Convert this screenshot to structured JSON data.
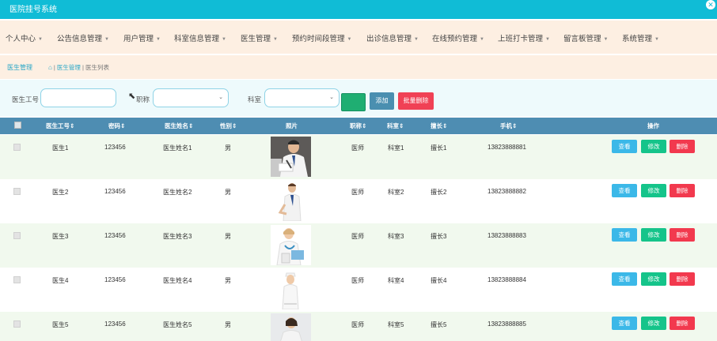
{
  "app": {
    "title": "医院挂号系统",
    "close_icon": "close-circle-icon"
  },
  "nav": {
    "items": [
      "个人中心",
      "公告信息管理",
      "用户管理",
      "科室信息管理",
      "医生管理",
      "预约时间段管理",
      "出诊信息管理",
      "在线预约管理",
      "上班打卡管理",
      "留言板管理",
      "系统管理"
    ]
  },
  "breadcrumb": {
    "section": "医生管理",
    "home_icon": "home-icon",
    "path": "医生管理",
    "current": "医生列表",
    "separator": "|"
  },
  "filters": {
    "doctor_no_label": "医生工号",
    "doctor_no_value": "",
    "title_label": "职称",
    "title_value": "",
    "dept_label": "科室",
    "dept_value": "",
    "search_label": "",
    "add_label": "添加",
    "bulk_delete_label": "批量删除"
  },
  "table": {
    "columns": [
      "医生工号",
      "密码",
      "医生姓名",
      "性别",
      "照片",
      "职称",
      "科室",
      "擅长",
      "手机",
      "操作"
    ],
    "sortable_icon": "sort-icon",
    "rows": [
      {
        "doctor_no": "医生1",
        "password": "123456",
        "name": "医生姓名1",
        "gender": "男",
        "photo": "doctor-photo-1",
        "title": "医师",
        "dept": "科室1",
        "specialty": "擅长1",
        "phone": "13823888881"
      },
      {
        "doctor_no": "医生2",
        "password": "123456",
        "name": "医生姓名2",
        "gender": "男",
        "photo": "doctor-photo-2",
        "title": "医师",
        "dept": "科室2",
        "specialty": "擅长2",
        "phone": "13823888882"
      },
      {
        "doctor_no": "医生3",
        "password": "123456",
        "name": "医生姓名3",
        "gender": "男",
        "photo": "doctor-photo-3",
        "title": "医师",
        "dept": "科室3",
        "specialty": "擅长3",
        "phone": "13823888883"
      },
      {
        "doctor_no": "医生4",
        "password": "123456",
        "name": "医生姓名4",
        "gender": "男",
        "photo": "doctor-photo-4",
        "title": "医师",
        "dept": "科室4",
        "specialty": "擅长4",
        "phone": "13823888884"
      },
      {
        "doctor_no": "医生5",
        "password": "123456",
        "name": "医生姓名5",
        "gender": "男",
        "photo": "doctor-photo-5",
        "title": "医师",
        "dept": "科室5",
        "specialty": "擅长5",
        "phone": "13823888885"
      }
    ],
    "actions": {
      "view": "查看",
      "edit": "修改",
      "delete": "删除"
    }
  },
  "colors": {
    "header": "#10bcd6",
    "nav_bg": "#fdefe2",
    "table_header": "#4e8db2",
    "view": "#3bb8e8",
    "edit": "#15c48a",
    "delete": "#f2394e",
    "add": "#4a8fb0",
    "search": "#1fae72"
  }
}
